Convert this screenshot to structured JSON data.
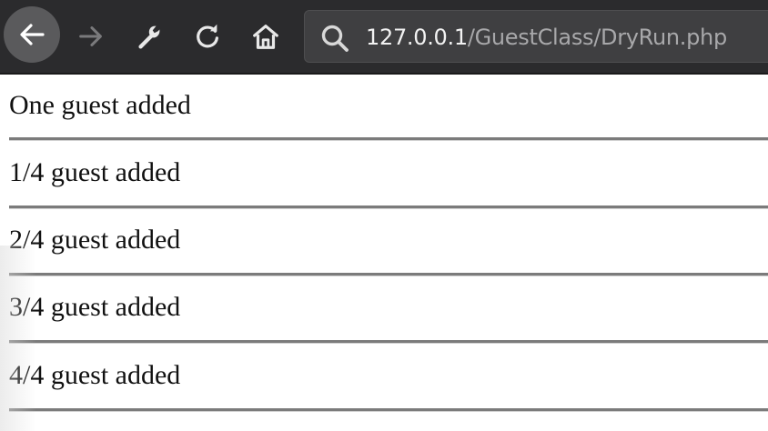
{
  "browser": {
    "nav": {
      "back_icon": "arrow-left-icon",
      "forward_icon": "arrow-right-icon",
      "settings_icon": "wrench-icon",
      "reload_icon": "reload-icon",
      "home_icon": "home-icon"
    },
    "address_bar": {
      "search_icon": "search-icon",
      "host": "127.0.0.1",
      "path": "/GuestClass/DryRun.php"
    },
    "colors": {
      "toolbar_bg": "#2b2b2d",
      "urlbar_bg": "#3f3f41",
      "host_text": "#f2f2f2",
      "path_text": "#a8a8aa"
    }
  },
  "page": {
    "entries": [
      "One guest added",
      "1/4 guest added",
      "2/4 guest added",
      "3/4 guest added",
      "4/4 guest added"
    ]
  }
}
